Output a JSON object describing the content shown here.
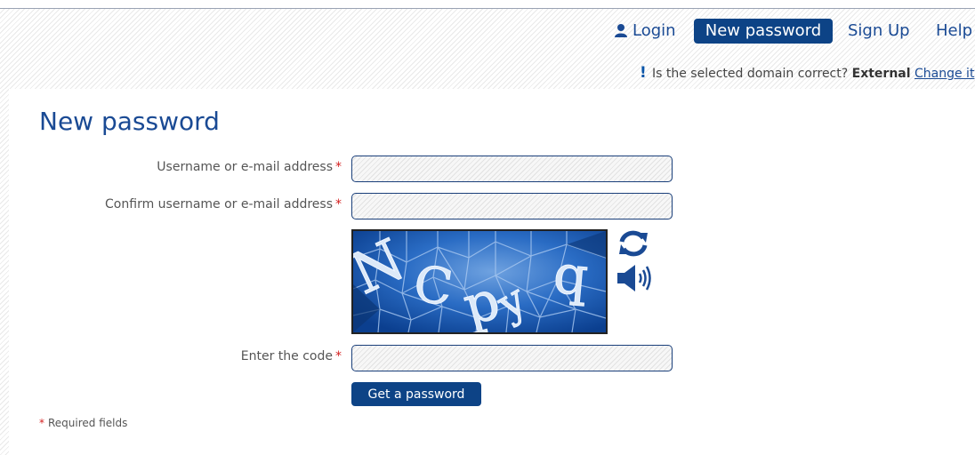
{
  "nav": {
    "login_label": "Login",
    "new_password_label": "New password",
    "signup_label": "Sign Up",
    "help_label": "Help"
  },
  "domain_notice": {
    "question": "Is the selected domain correct?",
    "domain": "External",
    "change_link": "Change it"
  },
  "page": {
    "title": "New password"
  },
  "form": {
    "required_marker": "*",
    "username_label": "Username or e-mail address",
    "username_value": "",
    "confirm_label": "Confirm username or e-mail address",
    "confirm_value": "",
    "captcha_text": "Ncpyq",
    "captcha_icons": {
      "refresh": "refresh-icon",
      "audio": "speaker-audio-icon"
    },
    "code_label": "Enter the code",
    "code_value": "",
    "submit_label": "Get a password",
    "required_note": "Required fields"
  },
  "colors": {
    "brand_blue": "#0d4386",
    "link_blue": "#1a4a94",
    "required_red": "#d42020"
  }
}
